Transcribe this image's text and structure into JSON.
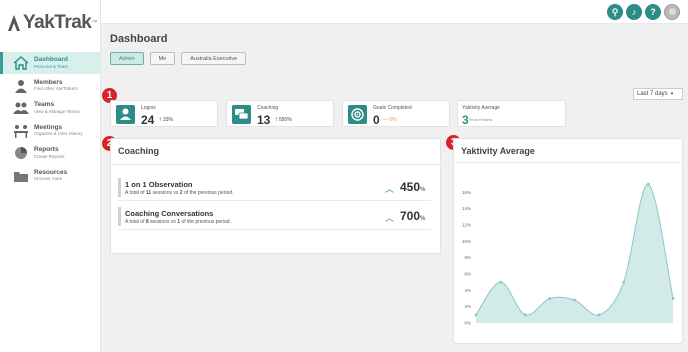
{
  "brand": {
    "name": "YakTrak",
    "tm": "™"
  },
  "nav": [
    {
      "title": "Dashboard",
      "sub": "Personal & Team",
      "icon": "home-icon"
    },
    {
      "title": "Members",
      "sub": "Find other YakTrakers",
      "icon": "person-icon"
    },
    {
      "title": "Teams",
      "sub": "View & Manage Teams",
      "icon": "group-icon"
    },
    {
      "title": "Meetings",
      "sub": "Organise & View History",
      "icon": "meetings-icon"
    },
    {
      "title": "Reports",
      "sub": "Create Reports",
      "icon": "pie-chart-icon"
    },
    {
      "title": "Resources",
      "sub": "Uncover more",
      "icon": "folder-icon"
    }
  ],
  "topbar": {
    "icons": [
      "search-icon",
      "bell-icon",
      "help-icon"
    ],
    "search_glyph": "⚲",
    "bell_glyph": "♪",
    "help_glyph": "?"
  },
  "page": {
    "title": "Dashboard"
  },
  "filters": {
    "options": [
      "Admin",
      "Me",
      "Australia Executive"
    ],
    "selected": "Admin"
  },
  "range": {
    "selected": "Last 7 days",
    "caret": "▾"
  },
  "badges": [
    "1",
    "2",
    "3"
  ],
  "stats": [
    {
      "label": "Logins",
      "value": "24",
      "change": "33%",
      "arrow": "🡑",
      "icon": "person-icon"
    },
    {
      "label": "Coaching",
      "value": "13",
      "change": "550%",
      "arrow": "🡑",
      "icon": "chat-icon"
    },
    {
      "label": "Goals Completed",
      "value": "0",
      "change": "0%",
      "arrow": "—",
      "icon": "target-icon"
    },
    {
      "label": "Yaktivity Average",
      "value": "3",
      "sub": "From 5 teams"
    }
  ],
  "coaching": {
    "title": "Coaching",
    "rows": [
      {
        "title": "1 on 1 Observation",
        "desc_pre": "A total of ",
        "desc_a": "11",
        "desc_mid": " sessions vs ",
        "desc_b": "2",
        "desc_post": " of the previous period.",
        "pct": "450",
        "pct_sign": "%",
        "arrow": "︿"
      },
      {
        "title": "Coaching Conversations",
        "desc_pre": "A total of ",
        "desc_a": "8",
        "desc_mid": " sessions vs ",
        "desc_b": "1",
        "desc_post": " of the previous period.",
        "pct": "700",
        "pct_sign": "%",
        "arrow": "︿"
      }
    ]
  },
  "yaktivity": {
    "title": "Yaktivity Average",
    "colors": {
      "line": "#8cc7c2",
      "fill": "#d3ebe8",
      "point": "#8cc7c2"
    }
  },
  "chart_data": {
    "type": "area",
    "title": "Yaktivity Average",
    "x": [
      0,
      1,
      2,
      3,
      4,
      5,
      6,
      7,
      8
    ],
    "values": [
      1,
      5,
      1,
      3,
      2.8,
      1,
      5,
      17,
      3
    ],
    "ylim": [
      0,
      18
    ],
    "yticks": [
      "0%",
      "2%",
      "4%",
      "6%",
      "8%",
      "10%",
      "12%",
      "14%",
      "16%",
      "18%"
    ],
    "grid": false,
    "smooth": true
  }
}
